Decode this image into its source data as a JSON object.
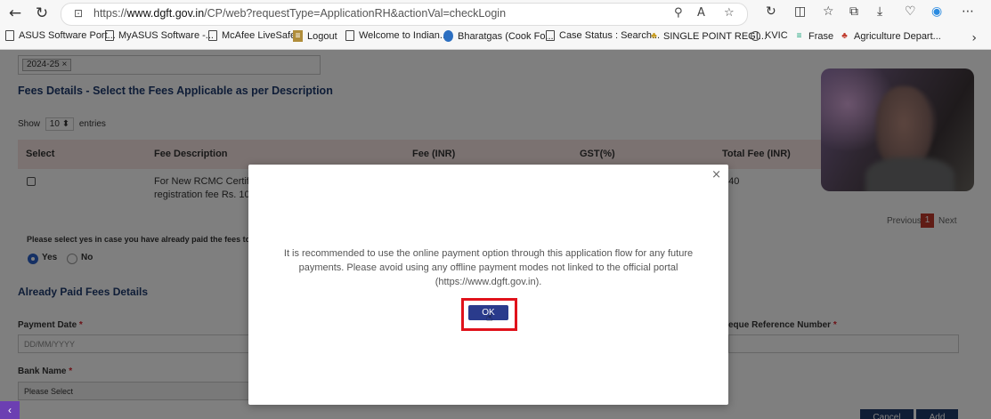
{
  "browser": {
    "url_prefix": "https://",
    "url_domain": "www.dgft.gov.in",
    "url_path": "/CP/web?requestType=ApplicationRH&actionVal=checkLogin",
    "bookmarks": [
      "ASUS Software Port...",
      "MyASUS Software -...",
      "McAfee LiveSafe",
      "Logout",
      "Welcome to Indian...",
      "Bharatgas (Cook Fo...",
      "Case Status : Search...",
      "SINGLE POINT REGI...",
      "KVIC",
      "Frase",
      "Agriculture Depart..."
    ]
  },
  "page": {
    "year_tag": "2024-25",
    "fees_title": "Fees Details - Select the Fees Applicable as per Description",
    "show_prefix": "Show",
    "show_value": "10",
    "show_suffix": "entries",
    "table_headers": [
      "Select",
      "Fee Description",
      "Fee (INR)",
      "GST(%)",
      "Total Fee (INR)"
    ],
    "row_desc_line1": "For New RCMC Certificat",
    "row_desc_line2": "registration fee Rs. 1000",
    "row_total": "440",
    "pager_prev": "Previous",
    "pager_current": "1",
    "pager_next": "Next",
    "epc_note": "Please select yes in case you have already paid the fees to EPC",
    "radio_yes": "Yes",
    "radio_no": "No",
    "paid_title": "Already Paid Fees Details",
    "payment_date_label": "Payment Date",
    "payment_date_placeholder": "DD/MM/YYYY",
    "cheque_label": "eque Reference Number",
    "bank_label": "Bank Name",
    "bank_value": "Please Select",
    "cancel": "Cancel",
    "add": "Add",
    "required_mark": "*"
  },
  "modal": {
    "close": "×",
    "message": "It is recommended to use the online payment option through this application flow for any future payments. Please avoid using any offline payment modes not linked to the official portal (https://www.dgft.gov.in).",
    "ok": "OK"
  },
  "colors": {
    "accent_navy": "#1f3a6b",
    "highlight_red": "#e0121b",
    "table_header_bg": "#f7e5e3"
  }
}
